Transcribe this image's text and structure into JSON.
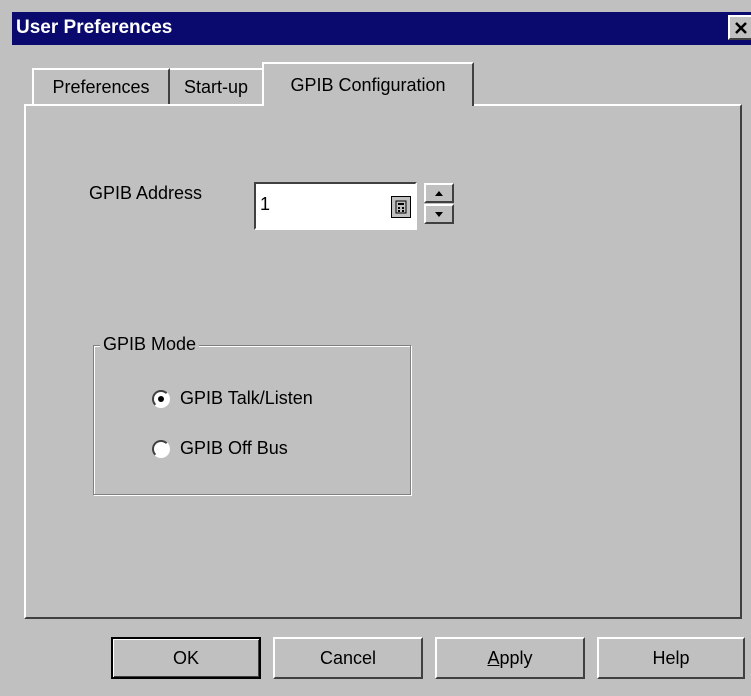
{
  "window": {
    "title": "User Preferences",
    "title_bar_color": "#0a0a6e",
    "close_icon": "close-icon"
  },
  "tabs": [
    {
      "label": "Preferences",
      "selected": false
    },
    {
      "label": "Start-up",
      "selected": false
    },
    {
      "label": "GPIB Configuration",
      "selected": true
    }
  ],
  "gpib_address": {
    "label": "GPIB Address",
    "value": "1",
    "calculator_icon": "calculator-icon",
    "spin_up_icon": "arrow-up-icon",
    "spin_down_icon": "arrow-down-icon"
  },
  "gpib_mode": {
    "group_label": "GPIB Mode",
    "options": [
      {
        "label": "GPIB Talk/Listen",
        "selected": true
      },
      {
        "label": "GPIB Off Bus",
        "selected": false
      }
    ]
  },
  "buttons": {
    "ok": "OK",
    "cancel": "Cancel",
    "apply": "Apply",
    "help": "Help"
  }
}
